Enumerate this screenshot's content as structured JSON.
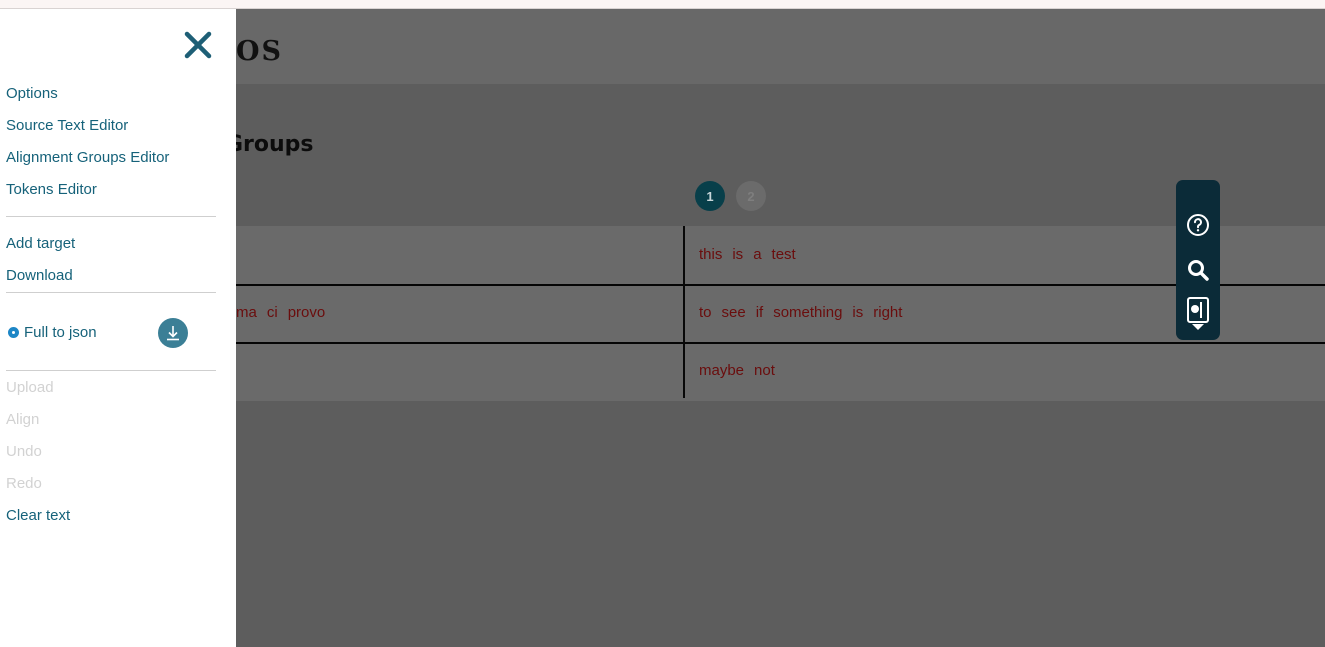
{
  "app": {
    "title_visible": "OS"
  },
  "section": {
    "title_visible": "Groups"
  },
  "pagination": {
    "pages": [
      "1",
      "2"
    ],
    "active": "1"
  },
  "groups": [
    {
      "source": [],
      "target": [
        "this",
        "is",
        "a",
        "test"
      ]
    },
    {
      "source": [
        "ma",
        "ci",
        "provo"
      ],
      "target": [
        "to",
        "see",
        "if",
        "something",
        "is",
        "right"
      ]
    },
    {
      "source": [],
      "target": [
        "maybe",
        "not"
      ]
    }
  ],
  "floating_toolbar": {
    "icons": [
      "help-icon",
      "search-icon",
      "panel-toggle-icon"
    ]
  },
  "sidepanel": {
    "nav": [
      "Options",
      "Source Text Editor",
      "Alignment Groups Editor",
      "Tokens Editor"
    ],
    "actions": [
      "Add target",
      "Download"
    ],
    "download_option": "Full to json",
    "disabled_actions": [
      "Upload",
      "Align",
      "Undo",
      "Redo"
    ],
    "clear": "Clear text"
  },
  "colors": {
    "accent": "#16627a",
    "toolbar": "#0b2b38",
    "token": "#6a0d0d",
    "active_page": "#083f4a"
  }
}
